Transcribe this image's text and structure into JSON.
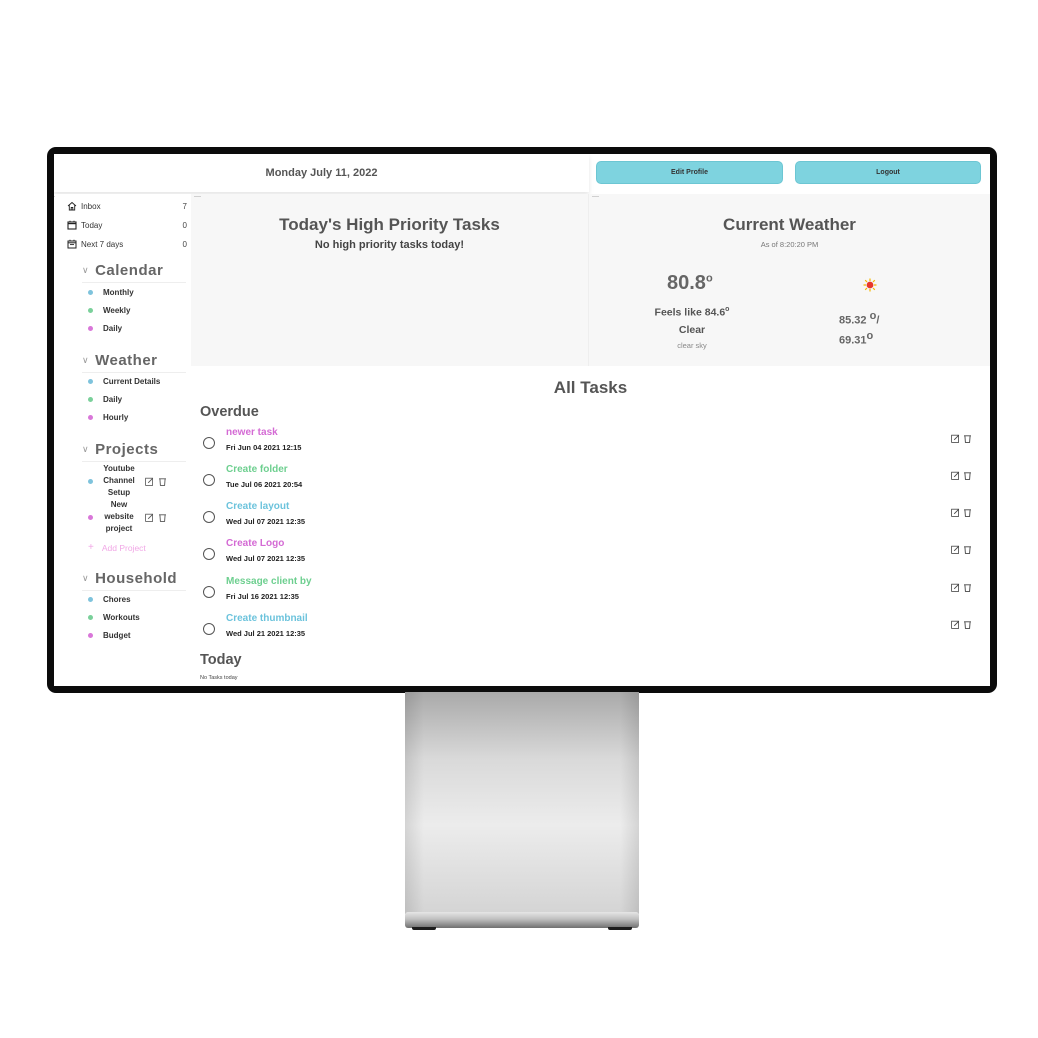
{
  "topbar": {
    "date": "Monday July 11, 2022",
    "edit_profile": "Edit Profile",
    "logout": "Logout"
  },
  "sidebar": {
    "nav": [
      {
        "label": "Inbox",
        "count": "7",
        "icon": "home-icon"
      },
      {
        "label": "Today",
        "count": "0",
        "icon": "calendar-icon"
      },
      {
        "label": "Next 7 days",
        "count": "0",
        "icon": "calendar-week-icon"
      }
    ],
    "calendar": {
      "title": "Calendar",
      "items": [
        {
          "label": "Monthly",
          "color": "#7ec3dc"
        },
        {
          "label": "Weekly",
          "color": "#7ad09a"
        },
        {
          "label": "Daily",
          "color": "#d977d9"
        }
      ]
    },
    "weather": {
      "title": "Weather",
      "items": [
        {
          "label": "Current Details",
          "color": "#7ec3dc"
        },
        {
          "label": "Daily",
          "color": "#7ad09a"
        },
        {
          "label": "Hourly",
          "color": "#d977d9"
        }
      ]
    },
    "projects": {
      "title": "Projects",
      "items": [
        {
          "line1": "Youtube",
          "line2": "Channel",
          "line3": "Setup",
          "color": "#7ec3dc"
        },
        {
          "line1": "New",
          "line2": "website",
          "line3": "project",
          "color": "#d977d9"
        }
      ],
      "add_label": "Add Project"
    },
    "household": {
      "title": "Household",
      "items": [
        {
          "label": "Chores",
          "color": "#7ec3dc"
        },
        {
          "label": "Workouts",
          "color": "#7ad09a"
        },
        {
          "label": "Budget",
          "color": "#d977d9"
        }
      ]
    }
  },
  "high_priority": {
    "title": "Today's High Priority Tasks",
    "empty": "No high priority tasks today!"
  },
  "weather": {
    "title": "Current Weather",
    "as_of": "As of 8:20:20 PM",
    "temp": "80.8",
    "deg": "o",
    "feels_like": "Feels like 84.6",
    "condition": "Clear",
    "description": "clear sky",
    "high": "85.32 ",
    "high_suffix": "/",
    "low": "69.31",
    "icon": "sun-icon"
  },
  "all_tasks": {
    "title": "All Tasks",
    "overdue_title": "Overdue",
    "overdue": [
      {
        "name": "newer task",
        "date": "Fri Jun 04 2021 12:15",
        "color": "#d46ad4"
      },
      {
        "name": "Create folder",
        "date": "Tue Jul 06 2021 20:54",
        "color": "#6dcf8f"
      },
      {
        "name": "Create layout",
        "date": "Wed Jul 07 2021 12:35",
        "color": "#6cc3dc"
      },
      {
        "name": "Create Logo",
        "date": "Wed Jul 07 2021 12:35",
        "color": "#d46ad4"
      },
      {
        "name": "Message client by",
        "date": "Fri Jul 16 2021 12:35",
        "color": "#6dcf8f"
      },
      {
        "name": "Create thumbnail",
        "date": "Wed Jul 21 2021 12:35",
        "color": "#6cc3dc"
      }
    ],
    "today_title": "Today",
    "today_empty": "No Tasks today"
  }
}
